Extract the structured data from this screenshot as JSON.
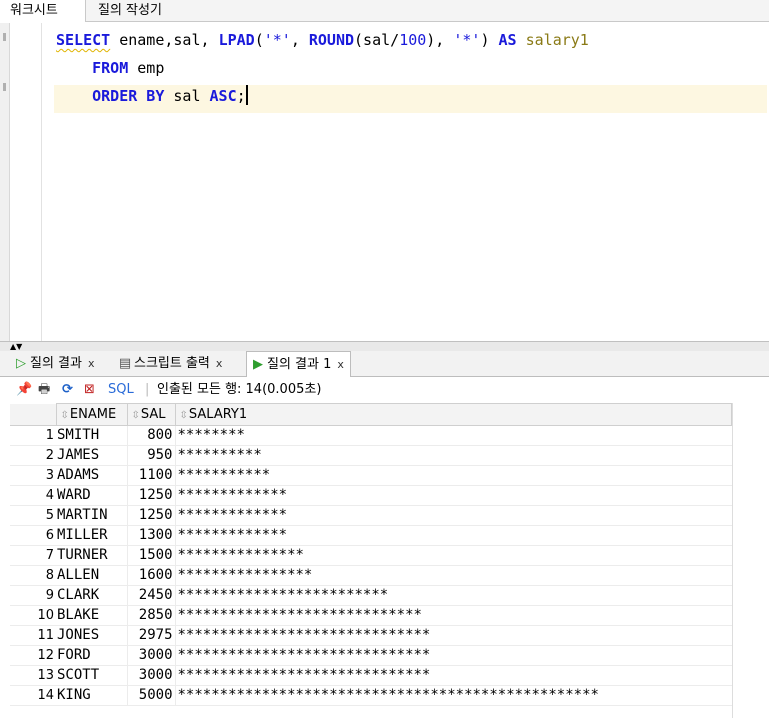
{
  "top_tabs": [
    "워크시트",
    "질의 작성기"
  ],
  "editor": {
    "line1": {
      "select": "SELECT",
      "cols": " ename,sal, ",
      "lpad": "LPAD",
      "open": "(",
      "str1": "'*'",
      "comma1": ", ",
      "round": "ROUND",
      "sal_expr": "(sal/",
      "num100": "100",
      "close1": "), ",
      "str2": "'*'",
      "close2": ") ",
      "as": "AS",
      "alias": " salary1"
    },
    "line2": {
      "from": "FROM",
      "table": " emp"
    },
    "line3": {
      "order_by": "ORDER BY",
      "col": " sal ",
      "asc": "ASC",
      "semi": ";"
    }
  },
  "result_tabs": [
    {
      "label": "질의 결과",
      "close": "x"
    },
    {
      "label": "스크립트 출력",
      "close": "x"
    },
    {
      "label": "질의 결과 1",
      "close": "x"
    }
  ],
  "toolbar": {
    "sql_label": "SQL",
    "separator": "|",
    "info": "인출된 모든 행: 14(0.005초)"
  },
  "grid": {
    "columns": [
      "ENAME",
      "SAL",
      "SALARY1"
    ],
    "rows": [
      {
        "n": "1",
        "ename": "SMITH",
        "sal": "800",
        "salary1": "********"
      },
      {
        "n": "2",
        "ename": "JAMES",
        "sal": "950",
        "salary1": "**********"
      },
      {
        "n": "3",
        "ename": "ADAMS",
        "sal": "1100",
        "salary1": "***********"
      },
      {
        "n": "4",
        "ename": "WARD",
        "sal": "1250",
        "salary1": "*************"
      },
      {
        "n": "5",
        "ename": "MARTIN",
        "sal": "1250",
        "salary1": "*************"
      },
      {
        "n": "6",
        "ename": "MILLER",
        "sal": "1300",
        "salary1": "*************"
      },
      {
        "n": "7",
        "ename": "TURNER",
        "sal": "1500",
        "salary1": "***************"
      },
      {
        "n": "8",
        "ename": "ALLEN",
        "sal": "1600",
        "salary1": "****************"
      },
      {
        "n": "9",
        "ename": "CLARK",
        "sal": "2450",
        "salary1": "*************************"
      },
      {
        "n": "10",
        "ename": "BLAKE",
        "sal": "2850",
        "salary1": "*****************************"
      },
      {
        "n": "11",
        "ename": "JONES",
        "sal": "2975",
        "salary1": "******************************"
      },
      {
        "n": "12",
        "ename": "FORD",
        "sal": "3000",
        "salary1": "******************************"
      },
      {
        "n": "13",
        "ename": "SCOTT",
        "sal": "3000",
        "salary1": "******************************"
      },
      {
        "n": "14",
        "ename": "KING",
        "sal": "5000",
        "salary1": "**************************************************"
      }
    ]
  }
}
